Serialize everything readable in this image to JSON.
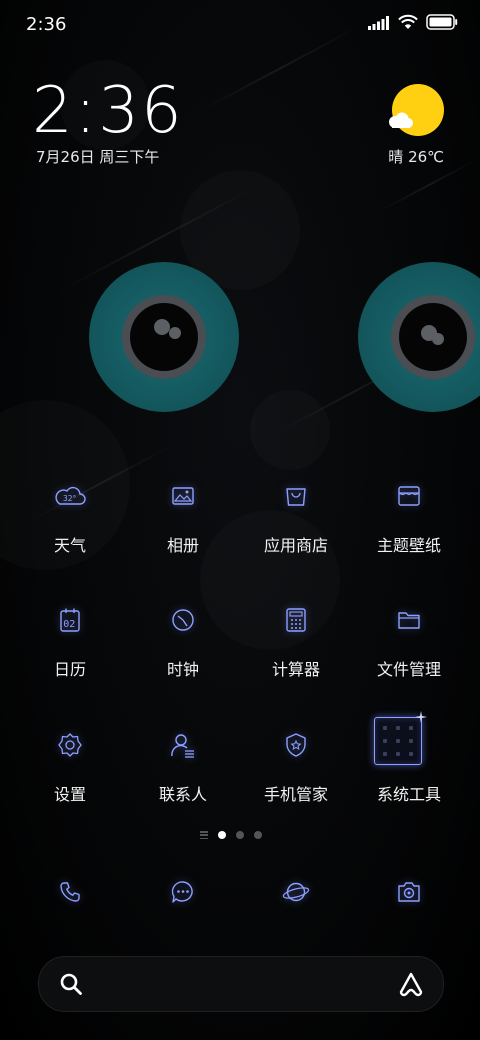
{
  "status_bar": {
    "time": "2:36"
  },
  "clock_widget": {
    "time": "2:36",
    "date": "7月26日 周三下午"
  },
  "weather_widget": {
    "condition_temp": "晴 26℃",
    "sun_color": "#ffd012"
  },
  "apps": [
    {
      "label": "天气",
      "icon": "weather-icon"
    },
    {
      "label": "相册",
      "icon": "gallery-icon"
    },
    {
      "label": "应用商店",
      "icon": "app-store-icon"
    },
    {
      "label": "主题壁纸",
      "icon": "themes-icon"
    },
    {
      "label": "日历",
      "icon": "calendar-icon"
    },
    {
      "label": "时钟",
      "icon": "clock-icon"
    },
    {
      "label": "计算器",
      "icon": "calculator-icon"
    },
    {
      "label": "文件管理",
      "icon": "file-manager-icon"
    },
    {
      "label": "设置",
      "icon": "settings-icon"
    },
    {
      "label": "联系人",
      "icon": "contacts-icon"
    },
    {
      "label": "手机管家",
      "icon": "security-icon"
    },
    {
      "label": "系统工具",
      "icon": "system-tools-folder-icon"
    }
  ],
  "weather_icon_text": "32°",
  "calendar_icon_text": "02",
  "dock": [
    {
      "icon": "phone-icon"
    },
    {
      "icon": "messages-icon"
    },
    {
      "icon": "browser-icon"
    },
    {
      "icon": "camera-icon"
    }
  ],
  "page_indicator": {
    "pages": 3,
    "active_page": 1
  },
  "colors": {
    "icon_glow": "#8ea0ff",
    "eye_teal": "#145a60",
    "background": "#000000"
  }
}
